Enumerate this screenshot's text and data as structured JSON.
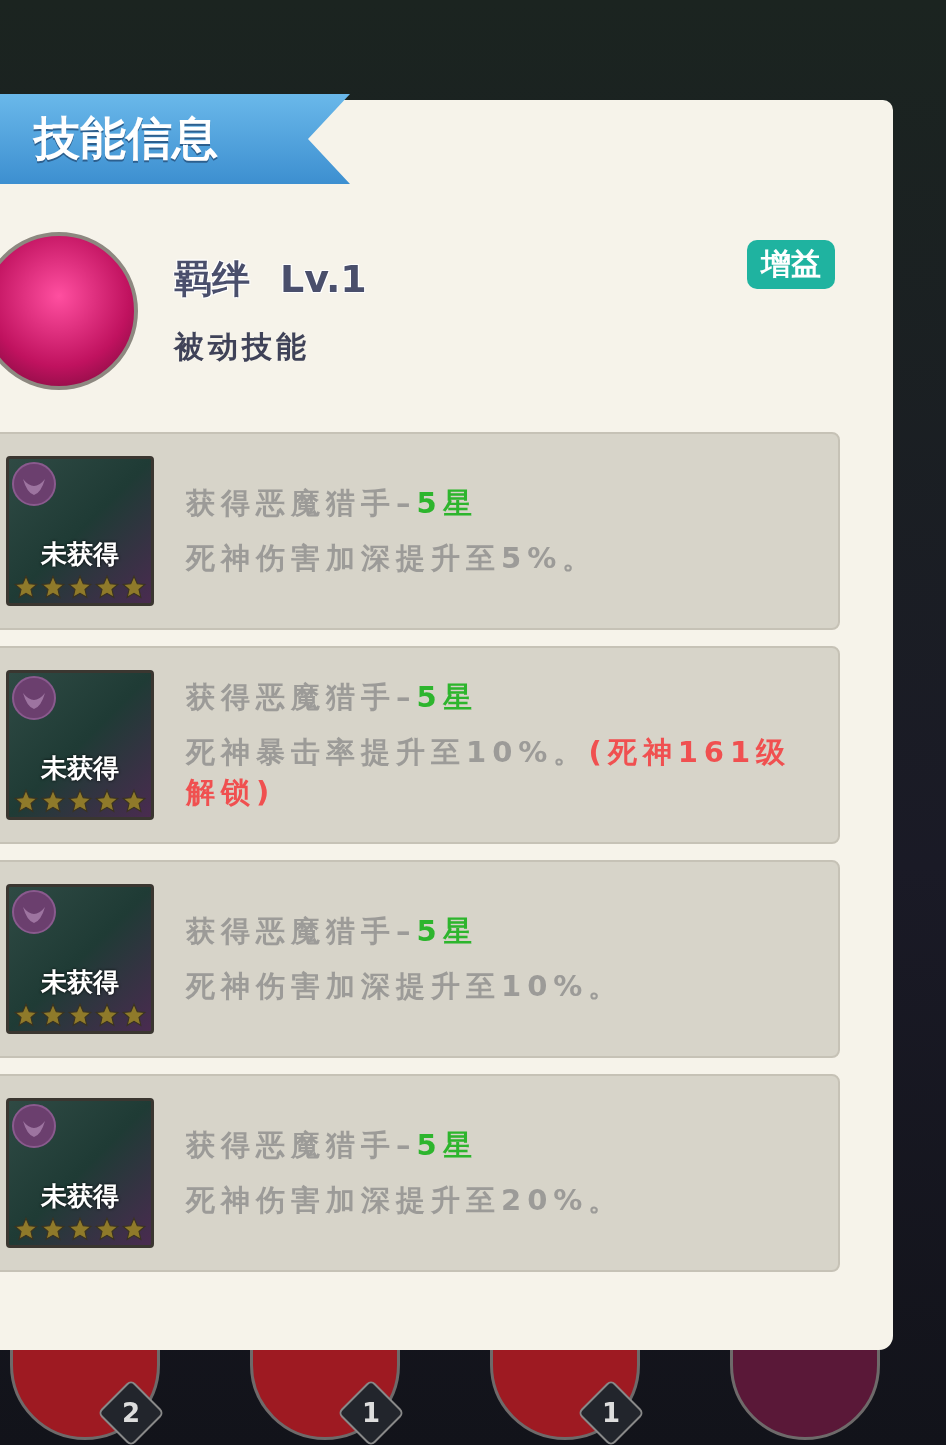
{
  "panel": {
    "title": "技能信息"
  },
  "skill": {
    "name": "羁绊",
    "level": "Lv.1",
    "type": "被动技能",
    "tag": "增益"
  },
  "bonds": [
    {
      "status": "未获得",
      "stars": 5,
      "condition": "获得恶魔猎手–",
      "requirement": "5星",
      "effect": "死神伤害加深提升至5%。"
    },
    {
      "status": "未获得",
      "stars": 5,
      "condition": "获得恶魔猎手–",
      "requirement": "5星",
      "effect": "死神暴击率提升至10%。",
      "lock_note": "(死神161级解锁)"
    },
    {
      "status": "未获得",
      "stars": 5,
      "condition": "获得恶魔猎手–",
      "requirement": "5星",
      "effect": "死神伤害加深提升至10%。"
    },
    {
      "status": "未获得",
      "stars": 5,
      "condition": "获得恶魔猎手–",
      "requirement": "5星",
      "effect": "死神伤害加深提升至20%。"
    }
  ],
  "skill_bar": [
    {
      "kind": "badged",
      "badge": "2"
    },
    {
      "kind": "badged",
      "badge": "1"
    },
    {
      "kind": "badged",
      "badge": "1"
    },
    {
      "kind": "plain"
    }
  ]
}
